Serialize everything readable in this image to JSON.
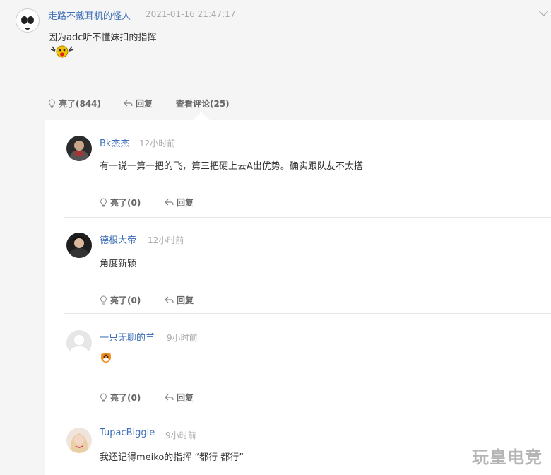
{
  "main_comment": {
    "username": "走路不戴耳机的怪人",
    "time": "2021-01-16 21:47:17",
    "text": "因为adc听不懂妹扣的指挥",
    "actions": {
      "like_label": "亮了(844)",
      "reply_label": "回复",
      "view_comments_label": "查看评论(25)"
    }
  },
  "replies": [
    {
      "username": "Bk杰杰",
      "time": "12小时前",
      "text": "有一说一第一把的飞，第三把硬上去A出优势。确实跟队友不太搭",
      "like_label": "亮了(0)",
      "reply_label": "回复"
    },
    {
      "username": "德根大帝",
      "time": "12小时前",
      "text": "角度新颖",
      "like_label": "亮了(0)",
      "reply_label": "回复"
    },
    {
      "username": "一只无聊的羊",
      "time": "9小时前",
      "text": "",
      "like_label": "亮了(0)",
      "reply_label": "回复"
    },
    {
      "username": "TupacBiggie",
      "time": "9小时前",
      "text": "我还记得meiko的指挥 “都行 都行”"
    }
  ],
  "watermark": "玩皇电竞",
  "colors": {
    "username": "#3f70b8",
    "time": "#aaaaaa",
    "background": "#f5f5f5",
    "panel": "#ffffff"
  }
}
